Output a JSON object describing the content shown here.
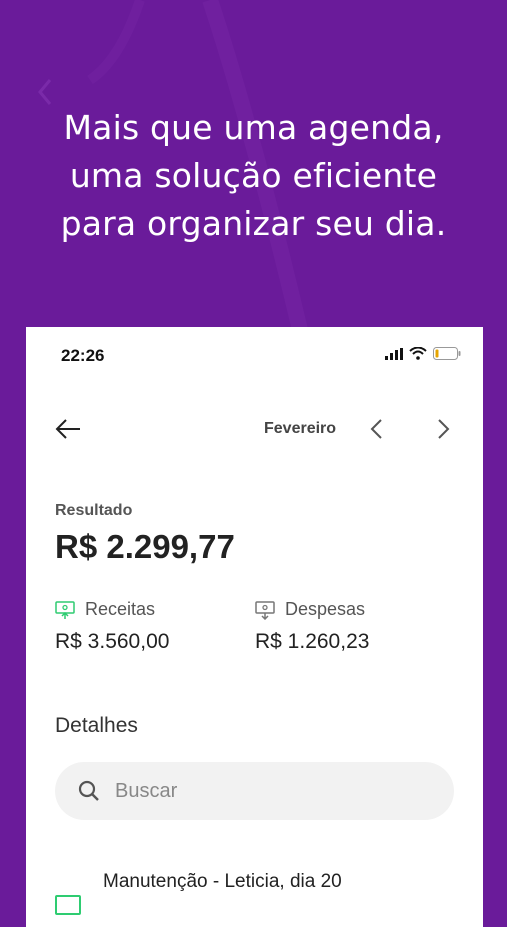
{
  "headline": {
    "line1": "Mais que uma agenda,",
    "line2": "uma solução eficiente",
    "line3": "para organizar seu dia."
  },
  "status_bar": {
    "time": "22:26"
  },
  "header": {
    "month": "Fevereiro"
  },
  "summary": {
    "result_label": "Resultado",
    "result_value": "R$ 2.299,77",
    "income_label": "Receitas",
    "income_value": "R$ 3.560,00",
    "expense_label": "Despesas",
    "expense_value": "R$ 1.260,23"
  },
  "details": {
    "title": "Detalhes",
    "search_placeholder": "Buscar",
    "items": [
      {
        "label": "Manutenção - Leticia, dia 20"
      }
    ]
  },
  "colors": {
    "background": "#6a1b9a",
    "card": "#ffffff",
    "income_icon": "#2ecc71",
    "expense_icon": "#777777",
    "search_bg": "#f2f2f2"
  }
}
